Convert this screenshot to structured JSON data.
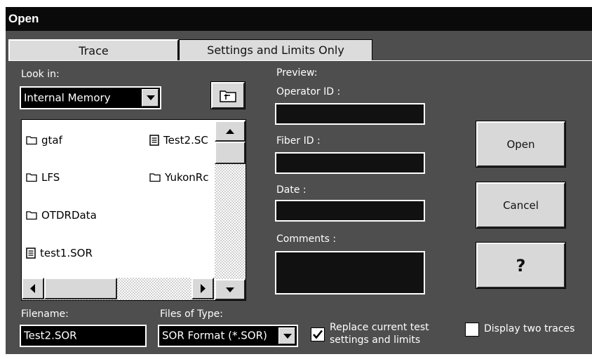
{
  "window": {
    "title": "Open"
  },
  "tabs": [
    {
      "label": "Trace"
    },
    {
      "label": "Settings and Limits Only"
    }
  ],
  "look_in": {
    "label": "Look in:",
    "value": "Internal Memory"
  },
  "files": [
    {
      "name": "gtaf",
      "type": "folder"
    },
    {
      "name": "Test2.SC",
      "type": "file"
    },
    {
      "name": "LFS",
      "type": "folder"
    },
    {
      "name": "YukonRc",
      "type": "folder"
    },
    {
      "name": "OTDRData",
      "type": "folder"
    },
    {
      "name": "test1.SOR",
      "type": "file"
    }
  ],
  "preview": {
    "label": "Preview:",
    "operator_label": "Operator ID :",
    "fiber_label": "Fiber ID :",
    "date_label": "Date :",
    "comments_label": "Comments  :"
  },
  "buttons": {
    "open": "Open",
    "cancel": "Cancel",
    "help": "?"
  },
  "filename": {
    "label": "Filename:",
    "value": "Test2.SOR"
  },
  "file_type": {
    "label": "Files of Type:",
    "value": "SOR Format (*.SOR)"
  },
  "replace_settings": {
    "label_line1": "Replace current test",
    "label_line2": "settings and limits",
    "checked": true
  },
  "display_two": {
    "label": "Display two traces",
    "checked": false
  }
}
